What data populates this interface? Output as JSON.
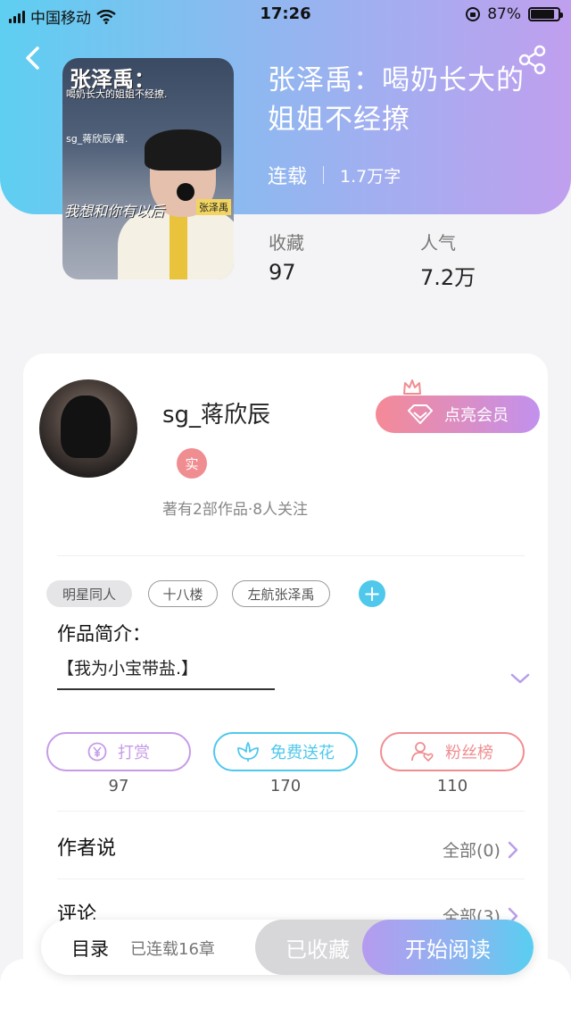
{
  "status_bar": {
    "carrier": "中国移动",
    "time": "17:26",
    "battery_percent": "87%",
    "battery_level": 0.87
  },
  "book": {
    "title": "张泽禹：喝奶长大的姐姐不经撩",
    "status": "连载",
    "word_count": "1.7万字",
    "cover": {
      "title_text": "张泽禹：",
      "subtitle_text": "喝奶长大的姐姐不经撩.",
      "author_text": "sg_蒋欣辰/著.",
      "handwriting_text": "我想和你有以后",
      "name_tag": "张泽禹"
    },
    "stats": [
      {
        "label": "收藏",
        "value": "97"
      },
      {
        "label": "人气",
        "value": "7.2万"
      }
    ]
  },
  "author": {
    "name": "sg_蒋欣辰",
    "badge": "实",
    "summary": "著有2部作品·8人关注",
    "vip_label": "点亮会员"
  },
  "tags": [
    "明星同人",
    "十八楼",
    "左航张泽禹"
  ],
  "add_tag_label": "+",
  "intro": {
    "title": "作品简介：",
    "text": "【我为小宝带盐.】"
  },
  "actions": [
    {
      "label": "打赏",
      "count": "97",
      "color": "#c59be8",
      "icon": "yen-coin-icon"
    },
    {
      "label": "免费送花",
      "count": "170",
      "color": "#4fc8ec",
      "icon": "flower-icon"
    },
    {
      "label": "粉丝榜",
      "count": "110",
      "color": "#f08d91",
      "icon": "fan-user-icon"
    }
  ],
  "sections": [
    {
      "title": "作者说",
      "link": "全部(0)"
    },
    {
      "title": "评论",
      "link": "全部(3)"
    }
  ],
  "bottom_bar": {
    "catalog": "目录",
    "chapters": "已连载16章",
    "favorited": "已收藏",
    "start_reading": "开始阅读"
  },
  "colors": {
    "header_gradient": [
      "#5ecff1",
      "#8fb8f0",
      "#c09fef"
    ],
    "accent_purple": "#c59be8",
    "accent_cyan": "#4fc8ec",
    "accent_pink": "#f08d91"
  }
}
